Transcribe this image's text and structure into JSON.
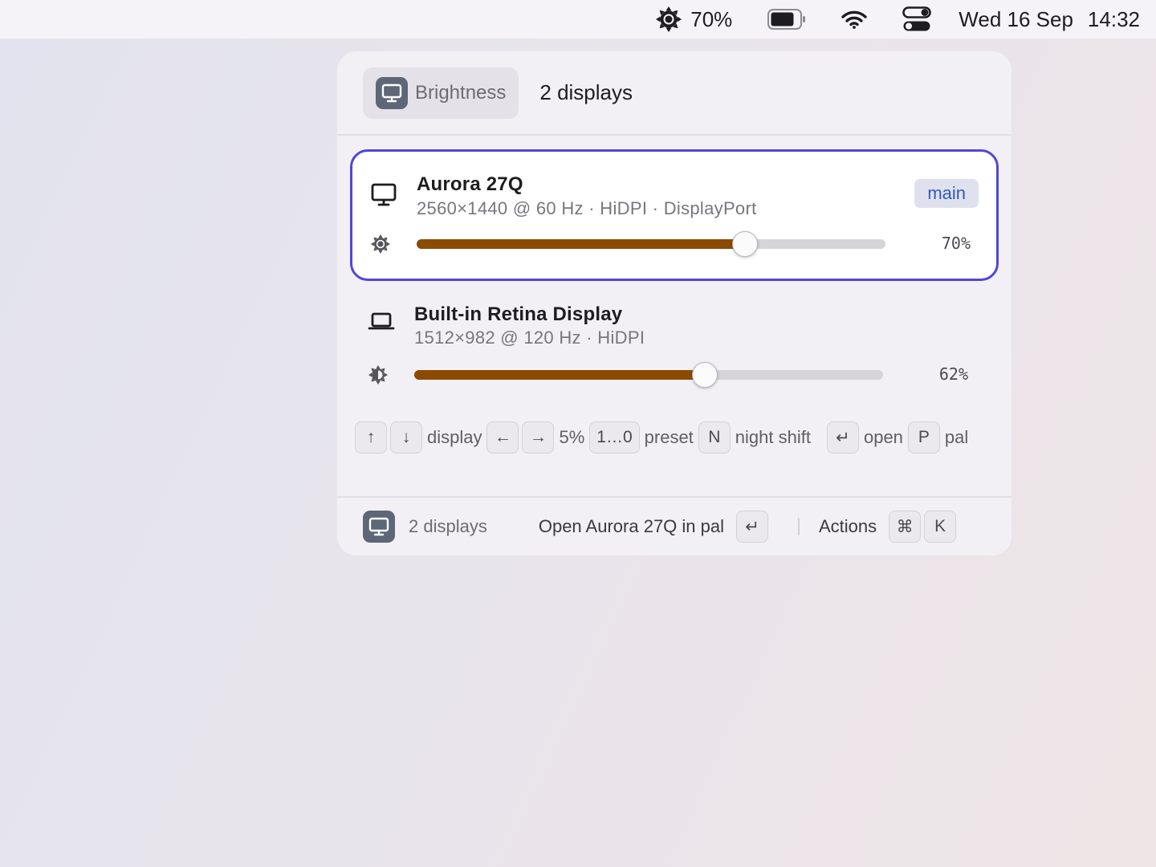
{
  "menubar": {
    "brightness_value": "70%",
    "date": "Wed 16 Sep",
    "time": "14:32",
    "icons": [
      "sun-icon",
      "battery-icon",
      "wifi-icon",
      "control-center-icon"
    ]
  },
  "header": {
    "crumb_label": "Brightness",
    "title": "2 displays",
    "icon": "display-icon"
  },
  "displays": [
    {
      "name": "Aurora 27Q",
      "spec": "2560×1440 @ 60 Hz · HiDPI · DisplayPort",
      "badge": "main",
      "brightness": 0.7,
      "brightness_label": "70%",
      "icon": "monitor-icon",
      "selected": true
    },
    {
      "name": "Built-in Retina Display",
      "spec": "1512×982 @ 120 Hz · HiDPI",
      "brightness": 0.62,
      "brightness_label": "62%",
      "icon": "laptop-icon",
      "selected": false
    }
  ],
  "shortcuts": {
    "up": "↑",
    "down": "↓",
    "display": "display",
    "left": "←",
    "right": "→",
    "step": "5%",
    "preset_key": "1…0",
    "preset": "preset",
    "night_key": "N",
    "night": "night shift",
    "open_key": "↵",
    "open": "open",
    "pal_key": "P",
    "pal": "pal"
  },
  "footer": {
    "label": "2 displays",
    "action": "Open Aurora 27Q in pal",
    "action_key": "↵",
    "actions": "Actions",
    "cmd_key": "⌘",
    "k_key": "K"
  },
  "colors": {
    "accent": "#5146d6",
    "slider_fill": "#8a4b00",
    "badge_text": "#3558b8"
  }
}
